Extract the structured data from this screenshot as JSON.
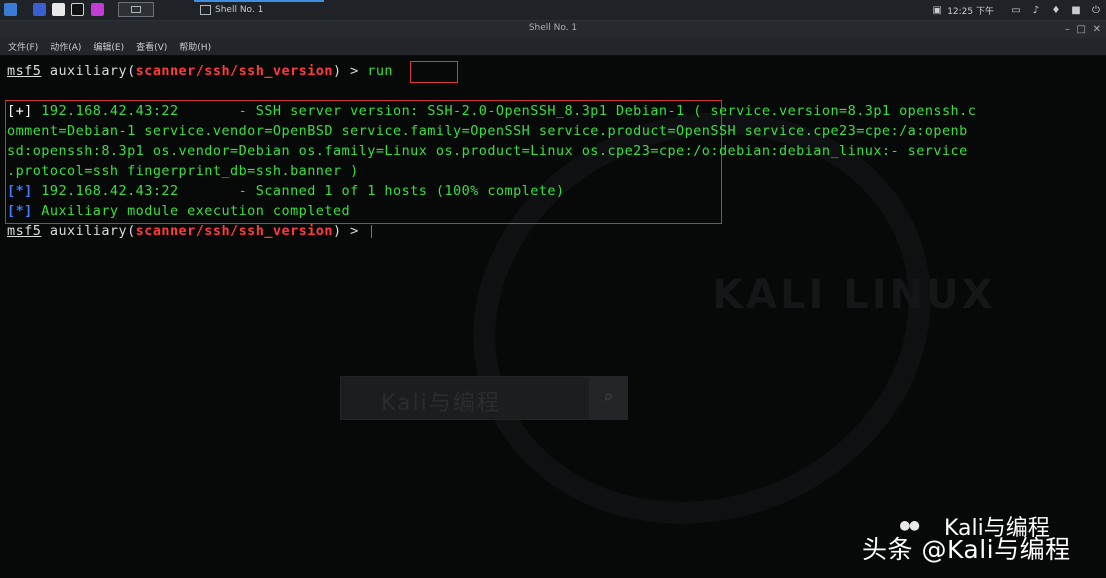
{
  "taskbar": {
    "task_label": "Shell No. 1",
    "time": "12:25 下午"
  },
  "window": {
    "title": "Shell No. 1",
    "menu": [
      "文件(F)",
      "动作(A)",
      "编辑(E)",
      "查看(V)",
      "帮助(H)"
    ]
  },
  "terminal": {
    "prompt1": {
      "msf": "msf5",
      "space": " auxiliary(",
      "module": "scanner/ssh/ssh_version",
      "close": ") > ",
      "cmd": "run"
    },
    "out1": {
      "tag": "[+]",
      "text": " 192.168.42.43:22       - SSH server version: SSH-2.0-OpenSSH_8.3p1 Debian-1 ( service.version=8.3p1 openssh.c"
    },
    "out2": "omment=Debian-1 service.vendor=OpenBSD service.family=OpenSSH service.product=OpenSSH service.cpe23=cpe:/a:openb",
    "out3": "sd:openssh:8.3p1 os.vendor=Debian os.family=Linux os.product=Linux os.cpe23=cpe:/o:debian:debian_linux:- service",
    "out4": ".protocol=ssh fingerprint_db=ssh.banner )",
    "out5": {
      "tag": "[*]",
      "text": " 192.168.42.43:22       - Scanned 1 of 1 hosts (100% complete)"
    },
    "out6": {
      "tag": "[*]",
      "text": " Auxiliary module execution completed"
    },
    "prompt2": {
      "msf": "msf5",
      "space": " auxiliary(",
      "module": "scanner/ssh/ssh_version",
      "close": ") > "
    }
  },
  "wallpaper": {
    "brand": "KALI LINUX",
    "search_text": "Kali与编程"
  },
  "watermark": {
    "wechat_label": "Kali与编程",
    "toutiao": "头条 @Kali与编程"
  },
  "colors": {
    "prompt_red": "#ff3b3b",
    "output_green": "#35e13a",
    "info_blue": "#3f7cff"
  }
}
